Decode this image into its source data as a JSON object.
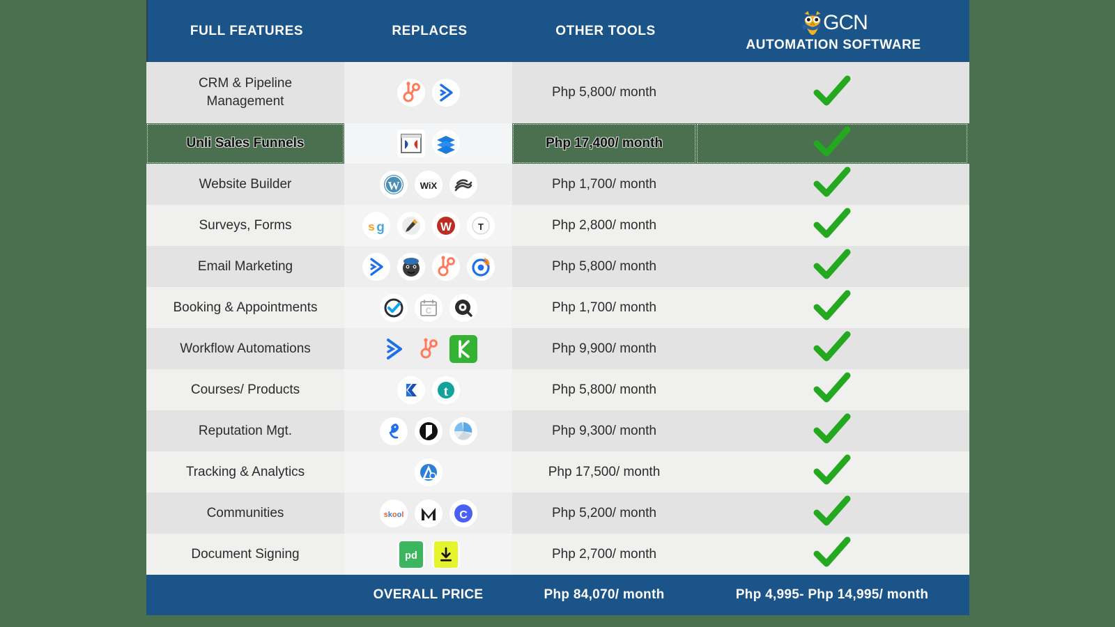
{
  "header": {
    "col_features": "FULL FEATURES",
    "col_replaces": "REPLACES",
    "col_other_tools": "OTHER TOOLS",
    "brand_name": "GCN",
    "brand_sub": "AUTOMATION SOFTWARE",
    "brand_logo_icon": "owl-logo-icon",
    "bg_color": "#1b5489"
  },
  "page": {
    "background_color": "#4a7050",
    "row_shade_a": "#e3e3e3",
    "row_shade_b": "#f0f0ef",
    "check_color": "#23a81f"
  },
  "rows": [
    {
      "feature": "CRM & Pipeline\nManagement",
      "other_tools": "Php 5,800/ month",
      "included": true,
      "replaces": [
        "hubspot-icon",
        "activecampaign-icon"
      ]
    },
    {
      "feature": "Unli Sales Funnels",
      "other_tools": "Php 17,400/ month",
      "included": true,
      "replaces": [
        "clickfunnels-icon",
        "leadpages-icon"
      ]
    },
    {
      "feature": "Website Builder",
      "other_tools": "Php 1,700/ month",
      "included": true,
      "replaces": [
        "wordpress-icon",
        "wix-icon",
        "squarespace-icon"
      ]
    },
    {
      "feature": "Surveys, Forms",
      "other_tools": "Php 2,800/ month",
      "included": true,
      "replaces": [
        "surveygizmo-icon",
        "jotform-icon",
        "wufoo-icon",
        "typeform-icon"
      ]
    },
    {
      "feature": "Email Marketing",
      "other_tools": "Php 5,800/ month",
      "included": true,
      "replaces": [
        "activecampaign-icon",
        "mailchimp-icon",
        "hubspot-icon",
        "mailerlite-icon"
      ]
    },
    {
      "feature": "Booking & Appointments",
      "other_tools": "Php 1,700/ month",
      "included": true,
      "replaces": [
        "calendly-icon",
        "calendar-icon",
        "acuity-icon"
      ]
    },
    {
      "feature": "Workflow Automations",
      "other_tools": "Php 9,900/ month",
      "included": true,
      "replaces": [
        "activecampaign-plain-icon",
        "hubspot-plain-icon",
        "keap-icon"
      ]
    },
    {
      "feature": "Courses/ Products",
      "other_tools": "Php 5,800/ month",
      "included": true,
      "replaces": [
        "kajabi-icon",
        "teachable-icon"
      ]
    },
    {
      "feature": "Reputation Mgt.",
      "other_tools": "Php 9,300/ month",
      "included": true,
      "replaces": [
        "birdeye-icon",
        "podium-icon",
        "trustpilot-icon"
      ]
    },
    {
      "feature": "Tracking & Analytics",
      "other_tools": "Php 17,500/ month",
      "included": true,
      "replaces": [
        "analytics-icon"
      ]
    },
    {
      "feature": "Communities",
      "other_tools": "Php 5,200/ month",
      "included": true,
      "replaces": [
        "skool-icon",
        "mighty-networks-icon",
        "circle-icon"
      ]
    },
    {
      "feature": "Document Signing",
      "other_tools": "Php 2,700/ month",
      "included": true,
      "replaces": [
        "pandadoc-icon",
        "signrequest-icon"
      ]
    }
  ],
  "footer": {
    "label": "OVERALL PRICE",
    "other_tools_total": "Php 84,070/ month",
    "gcn_total": "Php 4,995- Php 14,995/ month"
  }
}
